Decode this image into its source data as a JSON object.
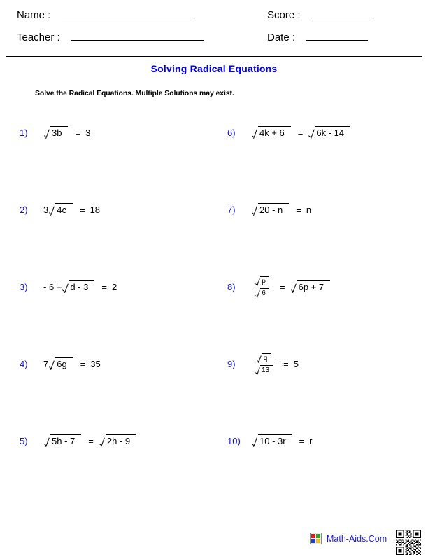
{
  "header": {
    "name_label": "Name :",
    "teacher_label": "Teacher :",
    "score_label": "Score :",
    "date_label": "Date :",
    "name_value": "",
    "teacher_value": "",
    "score_value": "",
    "date_value": ""
  },
  "title": "Solving Radical Equations",
  "title_color": "#0000ee",
  "instruction": "Solve the Radical Equations. Multiple Solutions may exist.",
  "number_color": "#1414dd",
  "problems": {
    "left": [
      {
        "number": "1)",
        "text": "√(3b) = 3",
        "parts": [
          {
            "kind": "radical",
            "content": "3b"
          },
          {
            "kind": "equals",
            "content": "="
          },
          {
            "kind": "text",
            "content": "3"
          }
        ]
      },
      {
        "number": "2)",
        "text": "3√(4c) = 18",
        "parts": [
          {
            "kind": "coef",
            "content": "3"
          },
          {
            "kind": "radical",
            "content": "4c"
          },
          {
            "kind": "equals",
            "content": "="
          },
          {
            "kind": "text",
            "content": "18"
          }
        ]
      },
      {
        "number": "3)",
        "text": "- 6 + √(d - 3) = 2",
        "parts": [
          {
            "kind": "text",
            "content": "- 6 +"
          },
          {
            "kind": "radical",
            "content": "d - 3"
          },
          {
            "kind": "equals",
            "content": "="
          },
          {
            "kind": "text",
            "content": "2"
          }
        ]
      },
      {
        "number": "4)",
        "text": "7√(6g) = 35",
        "parts": [
          {
            "kind": "coef",
            "content": "7"
          },
          {
            "kind": "radical",
            "content": "6g"
          },
          {
            "kind": "equals",
            "content": "="
          },
          {
            "kind": "text",
            "content": "35"
          }
        ]
      },
      {
        "number": "5)",
        "text": "√(5h - 7) = √(2h - 9)",
        "parts": [
          {
            "kind": "radical",
            "content": "5h - 7"
          },
          {
            "kind": "equals",
            "content": "="
          },
          {
            "kind": "radical",
            "content": "2h - 9"
          }
        ]
      }
    ],
    "right": [
      {
        "number": "6)",
        "text": "√(4k + 6) = √(6k - 14)",
        "parts": [
          {
            "kind": "radical",
            "content": "4k + 6"
          },
          {
            "kind": "equals",
            "content": "="
          },
          {
            "kind": "radical",
            "content": "6k - 14"
          }
        ]
      },
      {
        "number": "7)",
        "text": "√(20 - n) = n",
        "parts": [
          {
            "kind": "radical",
            "content": "20 - n"
          },
          {
            "kind": "equals",
            "content": "="
          },
          {
            "kind": "text",
            "content": "n"
          }
        ]
      },
      {
        "number": "8)",
        "text": "√p / √6 = √(6p + 7)",
        "parts": [
          {
            "kind": "fraction",
            "numerator": "p",
            "denominator": "6"
          },
          {
            "kind": "equals",
            "content": "="
          },
          {
            "kind": "radical",
            "content": "6p + 7"
          }
        ]
      },
      {
        "number": "9)",
        "text": "√q / √13 = 5",
        "parts": [
          {
            "kind": "fraction",
            "numerator": "q",
            "denominator": "13"
          },
          {
            "kind": "equals",
            "content": "="
          },
          {
            "kind": "text",
            "content": "5"
          }
        ]
      },
      {
        "number": "10)",
        "text": "√(10 - 3r) = r",
        "parts": [
          {
            "kind": "radical",
            "content": "10 - 3r"
          },
          {
            "kind": "equals",
            "content": "="
          },
          {
            "kind": "text",
            "content": "r"
          }
        ]
      }
    ]
  },
  "footer": {
    "brand_text": "Math-Aids.Com",
    "brand_color": "#1a1add",
    "icon_name": "calculator-icon",
    "qr_name": "qr-code"
  }
}
